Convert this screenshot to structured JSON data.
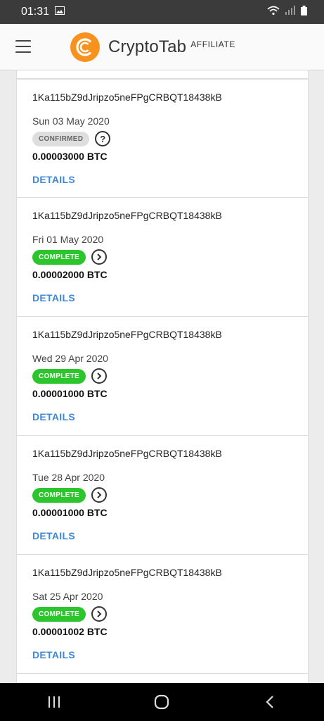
{
  "status_bar": {
    "time": "01:31"
  },
  "header": {
    "brand": "CryptoTab",
    "brand_sub": "AFFILIATE",
    "brand_color": "#f7921e"
  },
  "transactions": [
    {
      "address": "1Ka115bZ9dJripzo5neFPgCRBQT18438kB",
      "date": "Sun 03 May 2020",
      "status": "CONFIRMED",
      "status_icon": "question-icon",
      "amount": "0.00003000 BTC",
      "details": "DETAILS"
    },
    {
      "address": "1Ka115bZ9dJripzo5neFPgCRBQT18438kB",
      "date": "Fri 01 May 2020",
      "status": "COMPLETE",
      "status_icon": "chevron-right-icon",
      "amount": "0.00002000 BTC",
      "details": "DETAILS"
    },
    {
      "address": "1Ka115bZ9dJripzo5neFPgCRBQT18438kB",
      "date": "Wed 29 Apr 2020",
      "status": "COMPLETE",
      "status_icon": "chevron-right-icon",
      "amount": "0.00001000 BTC",
      "details": "DETAILS"
    },
    {
      "address": "1Ka115bZ9dJripzo5neFPgCRBQT18438kB",
      "date": "Tue 28 Apr 2020",
      "status": "COMPLETE",
      "status_icon": "chevron-right-icon",
      "amount": "0.00001000 BTC",
      "details": "DETAILS"
    },
    {
      "address": "1Ka115bZ9dJripzo5neFPgCRBQT18438kB",
      "date": "Sat 25 Apr 2020",
      "status": "COMPLETE",
      "status_icon": "chevron-right-icon",
      "amount": "0.00001002 BTC",
      "details": "DETAILS"
    }
  ],
  "colors": {
    "complete": "#2cc52c",
    "confirmed": "#dedede",
    "link": "#3f88d8"
  }
}
